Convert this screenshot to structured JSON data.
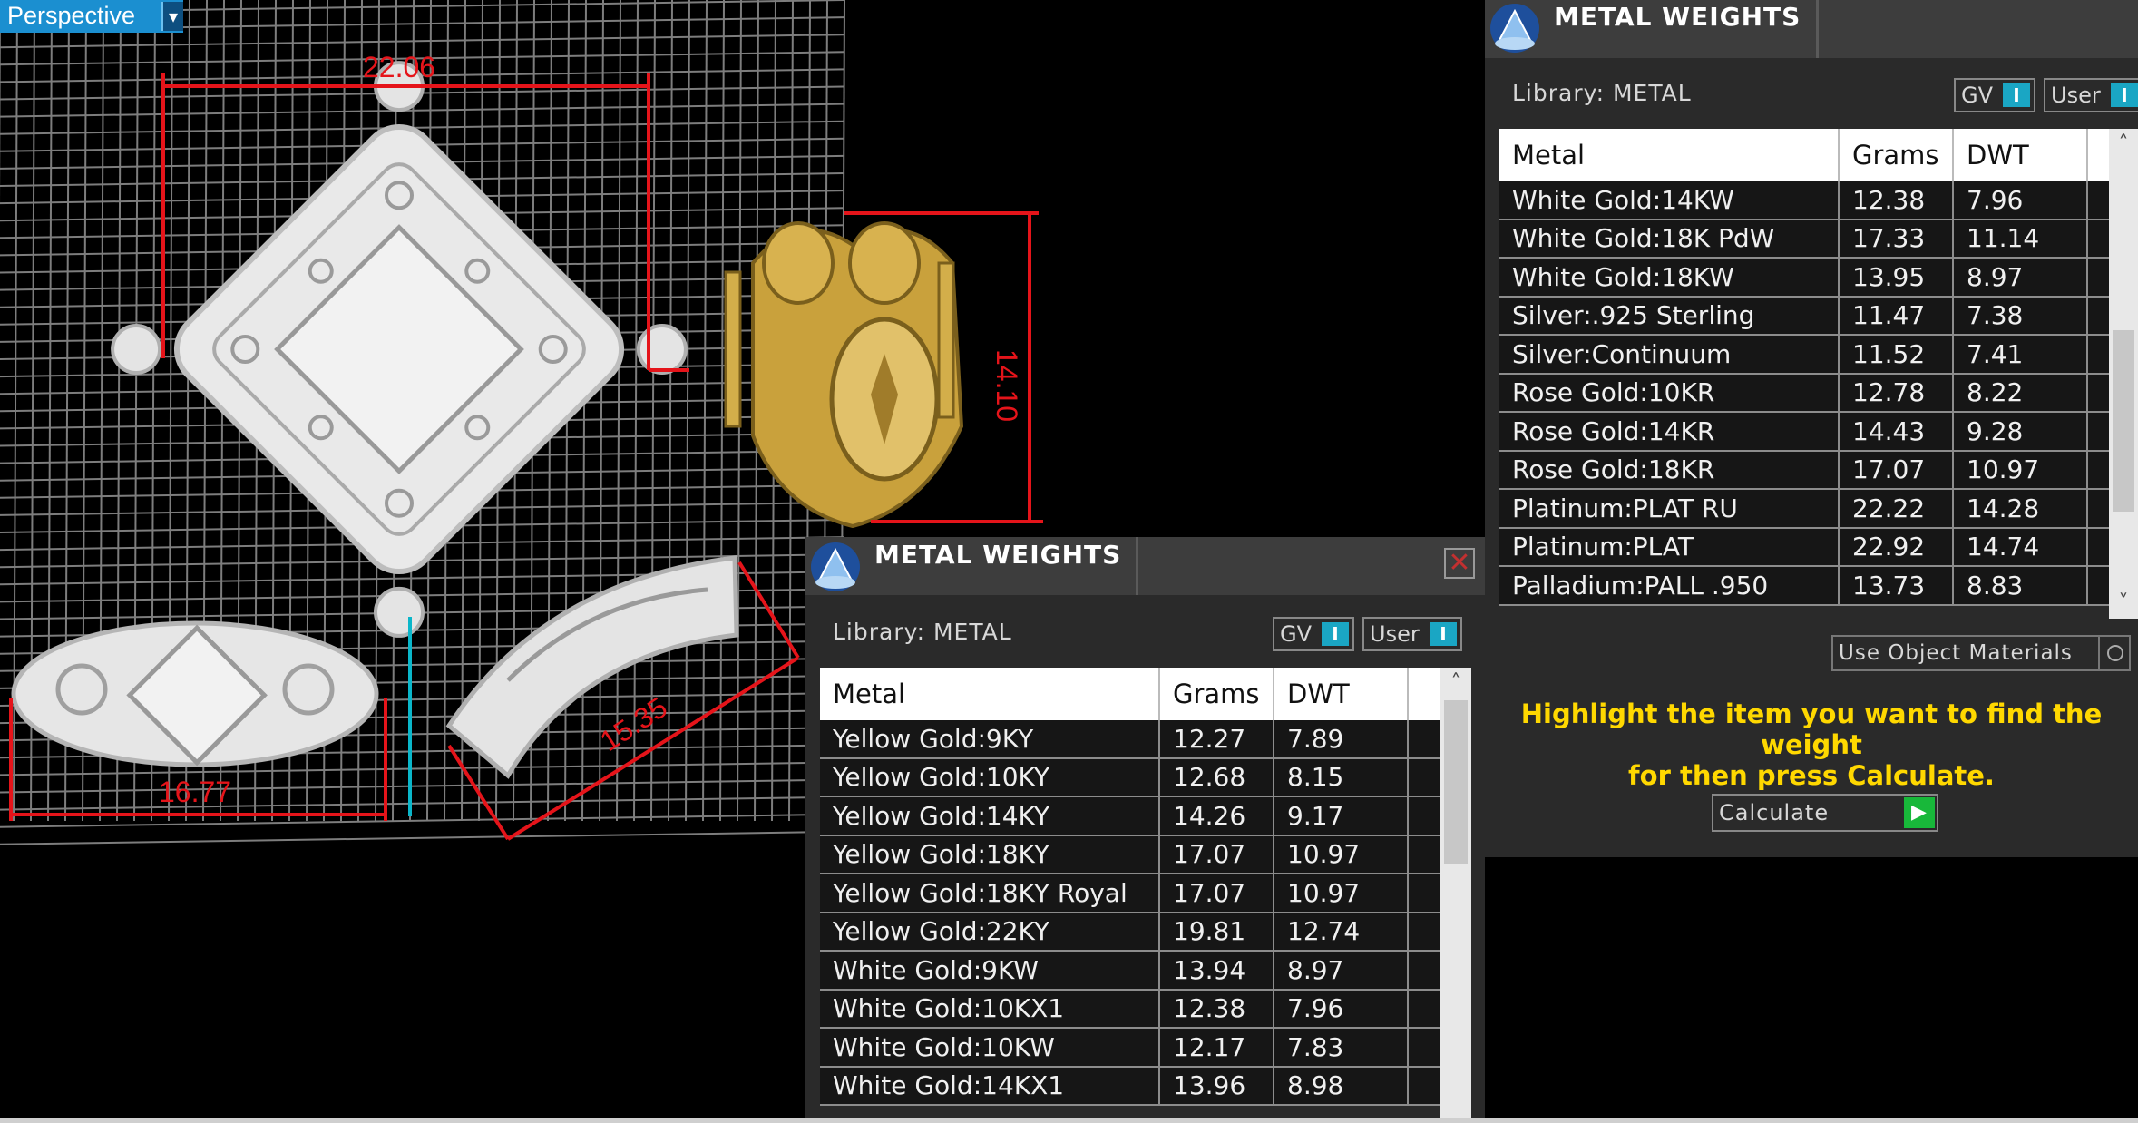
{
  "viewport": {
    "label": "Perspective",
    "dropdown_glyph": "▾",
    "dimensions": [
      "22.06",
      "14.10",
      "16.77",
      "15.35"
    ],
    "grid_color": "#7d7d7d",
    "dimension_color": "#e5141a"
  },
  "panel_front": {
    "title": "METAL WEIGHTS",
    "close_glyph": "✕",
    "library": "Library: METAL",
    "toggle_gv": "GV",
    "toggle_user": "User",
    "toggle_knob": "I",
    "columns": [
      "Metal",
      "Grams",
      "DWT"
    ],
    "rows": [
      [
        "Yellow Gold:9KY",
        "12.27",
        "7.89"
      ],
      [
        "Yellow Gold:10KY",
        "12.68",
        "8.15"
      ],
      [
        "Yellow Gold:14KY",
        "14.26",
        "9.17"
      ],
      [
        "Yellow Gold:18KY",
        "17.07",
        "10.97"
      ],
      [
        "Yellow Gold:18KY Royal",
        "17.07",
        "10.97"
      ],
      [
        "Yellow Gold:22KY",
        "19.81",
        "12.74"
      ],
      [
        "White Gold:9KW",
        "13.94",
        "8.97"
      ],
      [
        "White Gold:10KX1",
        "12.38",
        "7.96"
      ],
      [
        "White Gold:10KW",
        "12.17",
        "7.83"
      ],
      [
        "White Gold:14KX1",
        "13.96",
        "8.98"
      ]
    ]
  },
  "panel_back": {
    "title": "METAL WEIGHTS",
    "library": "Library: METAL",
    "toggle_gv": "GV",
    "toggle_user": "User",
    "toggle_knob": "I",
    "columns": [
      "Metal",
      "Grams",
      "DWT"
    ],
    "rows": [
      [
        "White Gold:14KW",
        "12.38",
        "7.96"
      ],
      [
        "White Gold:18K PdW",
        "17.33",
        "11.14"
      ],
      [
        "White Gold:18KW",
        "13.95",
        "8.97"
      ],
      [
        "Silver:.925 Sterling",
        "11.47",
        "7.38"
      ],
      [
        "Silver:Continuum",
        "11.52",
        "7.41"
      ],
      [
        "Rose Gold:10KR",
        "12.78",
        "8.22"
      ],
      [
        "Rose Gold:14KR",
        "14.43",
        "9.28"
      ],
      [
        "Rose Gold:18KR",
        "17.07",
        "10.97"
      ],
      [
        "Platinum:PLAT RU",
        "22.22",
        "14.28"
      ],
      [
        "Platinum:PLAT",
        "22.92",
        "14.74"
      ],
      [
        "Palladium:PALL .950",
        "13.73",
        "8.83"
      ]
    ],
    "use_object_materials": "Use Object Materials",
    "hint_line1": "Highlight the item you want to find the weight",
    "hint_line2": "for then press Calculate.",
    "calculate_label": "Calculate",
    "calculate_glyph": "▶"
  },
  "colors": {
    "accent": "#1aa6c4",
    "hint": "#ffd800",
    "panel_bg": "#2a2a2a",
    "go_button": "#18b83a"
  }
}
